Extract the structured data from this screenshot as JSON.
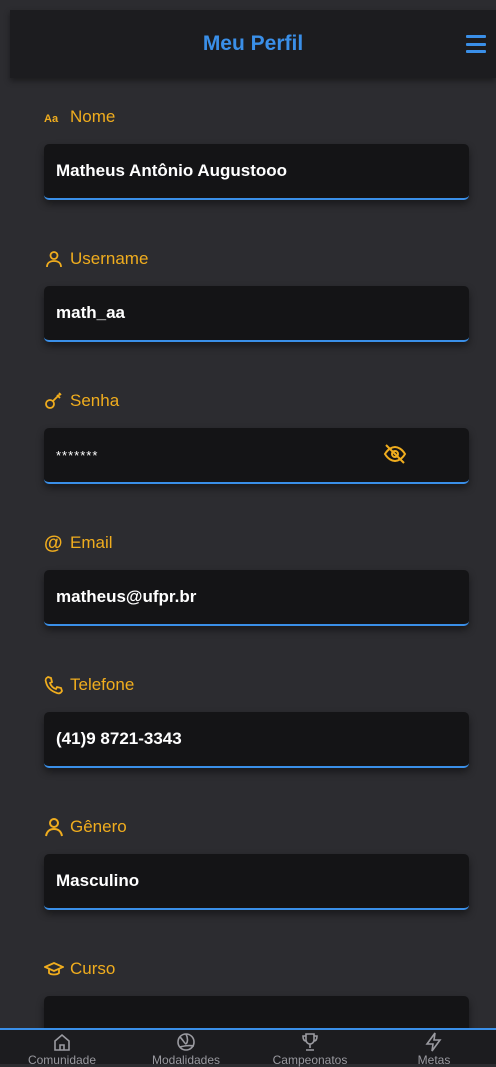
{
  "header": {
    "title": "Meu Perfil"
  },
  "colors": {
    "accent": "#3a8fe8",
    "label": "#f0ad1e",
    "input_bg": "#141416",
    "background": "#2c2c30"
  },
  "fields": [
    {
      "label": "Nome",
      "value": "Matheus Antônio Augustooo",
      "icon": "font-icon"
    },
    {
      "label": "Username",
      "value": "math_aa",
      "icon": "user-icon"
    },
    {
      "label": "Senha",
      "value": "*******",
      "icon": "key-icon"
    },
    {
      "label": "Email",
      "value": "matheus@ufpr.br",
      "icon": "at-icon"
    },
    {
      "label": "Telefone",
      "value": "(41)9 8721-3343",
      "icon": "phone-icon"
    },
    {
      "label": "Gênero",
      "value": "Masculino",
      "icon": "user-icon"
    },
    {
      "label": "Curso",
      "value": "",
      "icon": "graduation-cap-icon"
    }
  ],
  "nav": [
    {
      "label": "Comunidade",
      "icon": "home-icon"
    },
    {
      "label": "Modalidades",
      "icon": "volleyball-icon"
    },
    {
      "label": "Campeonatos",
      "icon": "trophy-icon"
    },
    {
      "label": "Metas",
      "icon": "lightning-icon"
    }
  ]
}
